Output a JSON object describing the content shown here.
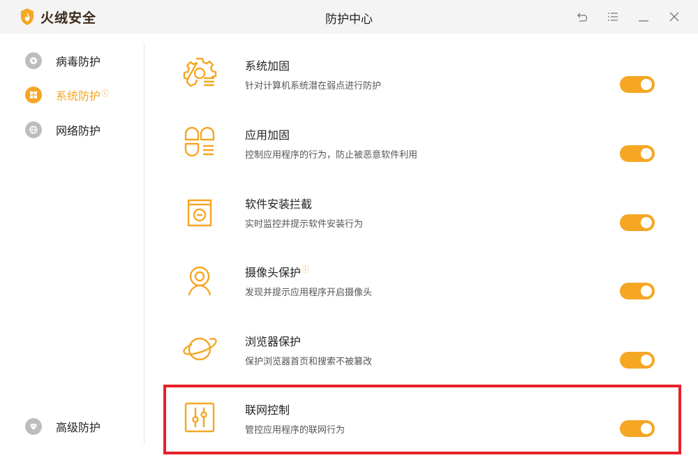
{
  "app": {
    "logo_text": "火绒安全",
    "window_title": "防护中心"
  },
  "colors": {
    "accent": "#f5a623",
    "highlight": "#e62129",
    "inactive_icon": "#bdbdbd"
  },
  "sidebar": {
    "items": [
      {
        "label": "病毒防护",
        "icon": "plus-circle-icon",
        "active": false,
        "badge": ""
      },
      {
        "label": "系统防护",
        "icon": "windows-icon",
        "active": true,
        "badge": "ⓘ"
      },
      {
        "label": "网络防护",
        "icon": "globe-icon",
        "active": false,
        "badge": ""
      }
    ],
    "bottom_item": {
      "label": "高级防护",
      "icon": "diamond-icon"
    }
  },
  "rows": [
    {
      "title": "系统加固",
      "badge": "",
      "desc": "针对计算机系统潜在弱点进行防护",
      "icon": "gear-shield-icon",
      "enabled": true
    },
    {
      "title": "应用加固",
      "badge": "",
      "desc": "控制应用程序的行为，防止被恶意软件利用",
      "icon": "app-grid-icon",
      "enabled": true
    },
    {
      "title": "软件安装拦截",
      "badge": "",
      "desc": "实时监控并提示软件安装行为",
      "icon": "install-box-icon",
      "enabled": true
    },
    {
      "title": "摄像头保护",
      "badge": "ⓘ",
      "desc": "发现并提示应用程序开启摄像头",
      "icon": "webcam-icon",
      "enabled": true
    },
    {
      "title": "浏览器保护",
      "badge": "",
      "desc": "保护浏览器首页和搜索不被篡改",
      "icon": "planet-icon",
      "enabled": true
    },
    {
      "title": "联网控制",
      "badge": "",
      "desc": "管控应用程序的联网行为",
      "icon": "sliders-icon",
      "enabled": true
    }
  ]
}
